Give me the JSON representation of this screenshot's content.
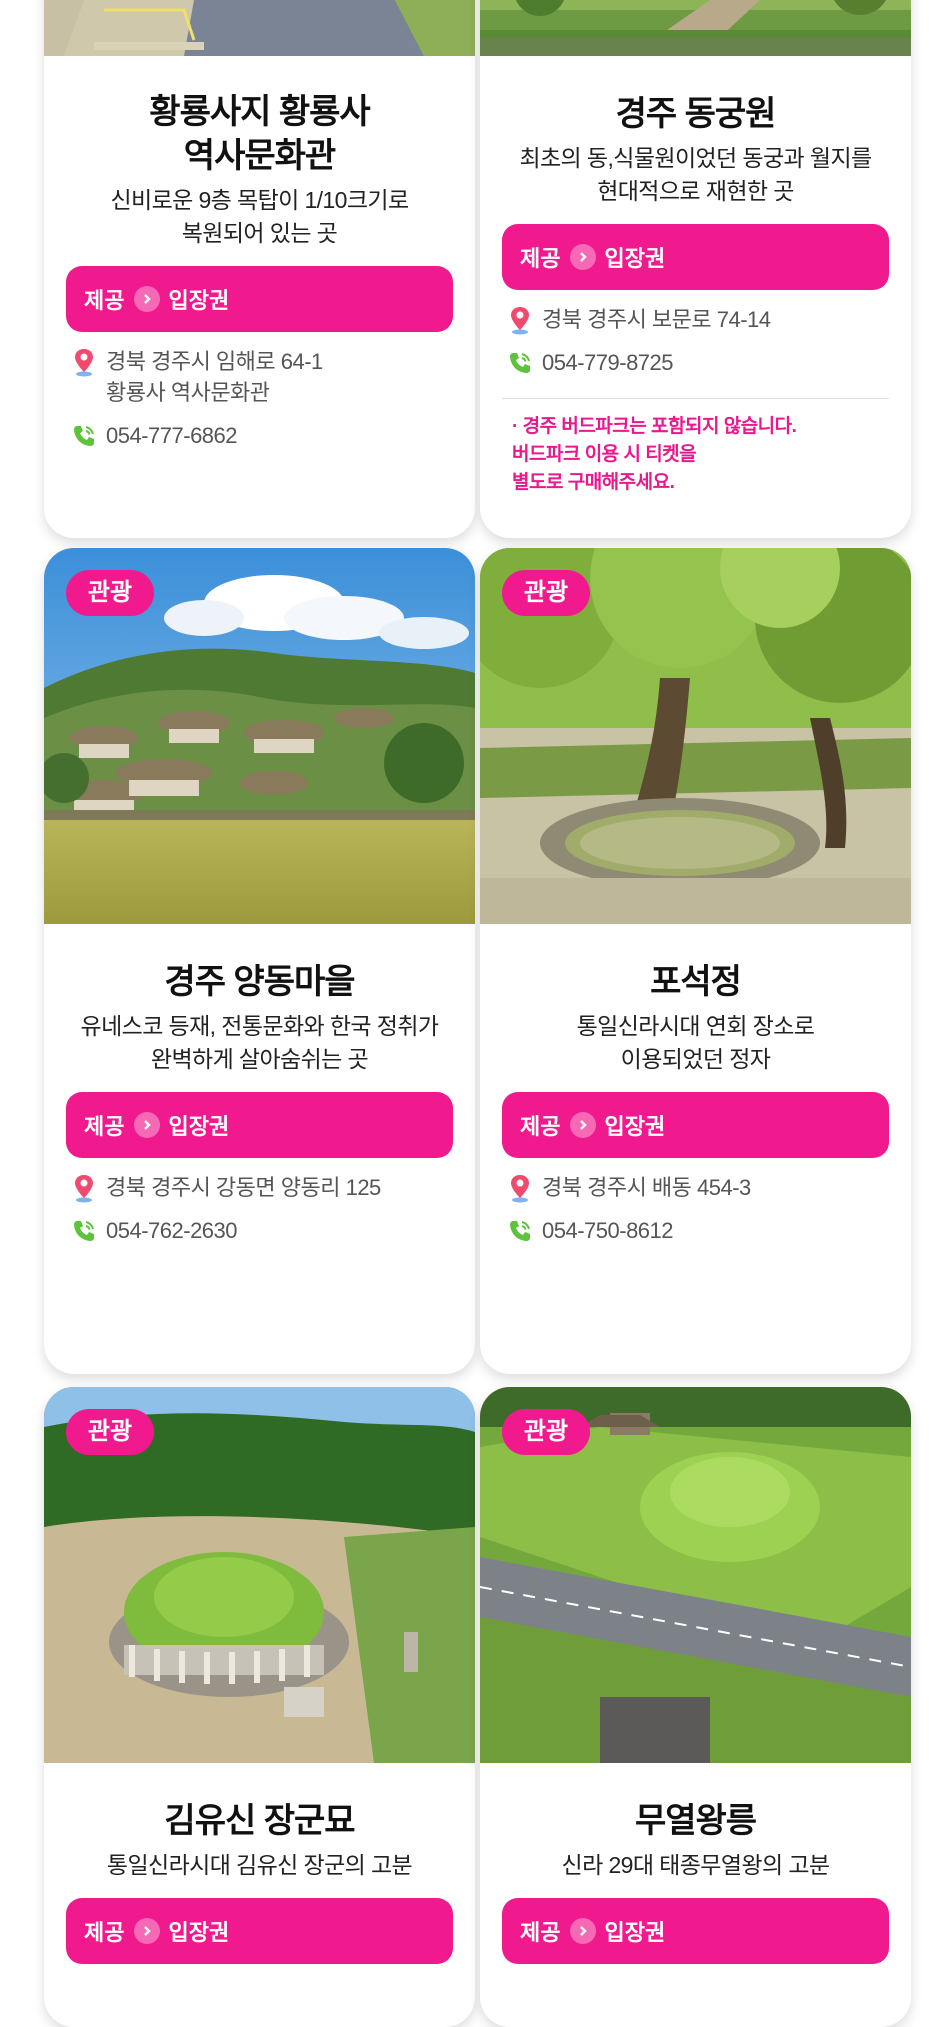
{
  "colors": {
    "accent": "#f0198e",
    "text": "#222222",
    "muted": "#555555"
  },
  "cards": [
    {
      "title": "황룡사지 황룡사\n역사문화관",
      "title_line1": "황룡사지 황룡사",
      "title_line2": "역사문화관",
      "desc": "신비로운 9층 목탑이 1/10크기로\n복원되어 있는 곳",
      "ticket_provided": "제공",
      "ticket_label": "입장권",
      "address": "경북 경주시 임해로 64-1\n황룡사 역사문화관",
      "phone": "054-777-6862"
    },
    {
      "title": "경주 동궁원",
      "desc": "최초의 동,식물원이었던 동궁과 월지를\n현대적으로 재현한 곳",
      "ticket_provided": "제공",
      "ticket_label": "입장권",
      "address": "경북 경주시 보문로 74-14",
      "phone": "054-779-8725",
      "notice": "· 경주 버드파크는 포함되지 않습니다.\n  버드파크  이용 시 티켓을\n  별도로 구매해주세요."
    },
    {
      "tag": "관광",
      "image": "yangdong-village-photo",
      "title": "경주 양동마을",
      "desc": "유네스코 등재, 전통문화와 한국 정취가\n완벽하게 살아숨쉬는 곳",
      "ticket_provided": "제공",
      "ticket_label": "입장권",
      "address": "경북 경주시 강동면 양동리 125",
      "phone": "054-762-2630"
    },
    {
      "tag": "관광",
      "image": "poseokjeong-photo",
      "title": "포석정",
      "desc": "통일신라시대 연회 장소로\n이용되었던 정자",
      "ticket_provided": "제공",
      "ticket_label": "입장권",
      "address": "경북 경주시 배동 454-3",
      "phone": "054-750-8612"
    },
    {
      "tag": "관광",
      "image": "kim-yusin-tomb-photo",
      "title": "김유신 장군묘",
      "desc": "통일신라시대 김유신 장군의 고분",
      "ticket_provided": "제공",
      "ticket_label": "입장권"
    },
    {
      "tag": "관광",
      "image": "muyeol-tomb-photo",
      "title": "무열왕릉",
      "desc": "신라 29대 태종무열왕의 고분",
      "ticket_provided": "제공",
      "ticket_label": "입장권"
    }
  ]
}
